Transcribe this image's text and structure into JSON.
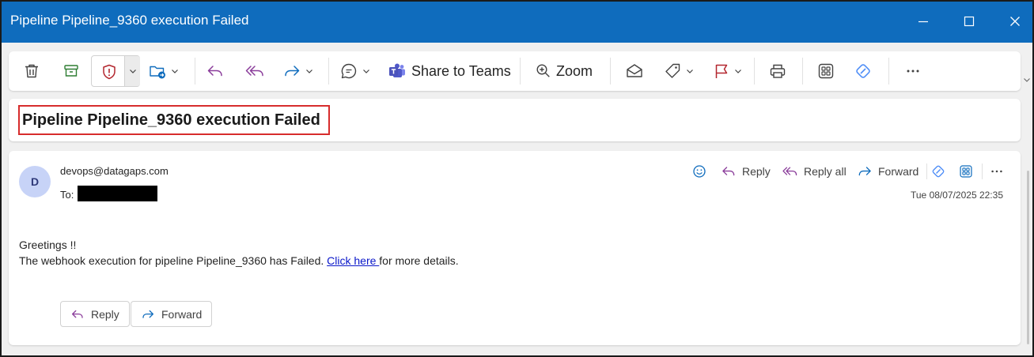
{
  "window": {
    "title": "Pipeline Pipeline_9360 execution Failed"
  },
  "toolbar": {
    "share_label": "Share to Teams",
    "zoom_label": "Zoom"
  },
  "message": {
    "subject": "Pipeline Pipeline_9360 execution Failed",
    "avatar_initial": "D",
    "sender": "devops@datagaps.com",
    "to_label": "To:",
    "date": "Tue 08/07/2025 22:35",
    "actions": {
      "reply": "Reply",
      "reply_all": "Reply all",
      "forward": "Forward"
    },
    "body": {
      "greeting": "Greetings !!",
      "line_prefix": "The webhook execution for pipeline Pipeline_9360 has Failed. ",
      "link_text": "Click here ",
      "line_suffix": "for more details."
    },
    "bottom_buttons": {
      "reply": "Reply",
      "forward": "Forward"
    }
  },
  "colors": {
    "titlebar": "#0f6cbd",
    "highlight_border": "#d72c2c",
    "reply_icon": "#8a3c9a",
    "forward_icon": "#0f6cbd",
    "link": "#0a17c9"
  },
  "icons": {
    "delete": "trash-icon",
    "archive": "archive-icon",
    "report": "shield-icon",
    "move": "folder-move-icon",
    "reply": "reply-arrow-icon",
    "reply_all": "reply-all-icon",
    "forward": "forward-arrow-icon",
    "comment": "chat-bubble-icon",
    "teams": "teams-icon",
    "zoom": "zoom-icon",
    "read": "envelope-open-icon",
    "tag": "tag-icon",
    "flag": "flag-icon",
    "print": "printer-icon",
    "apps": "apps-grid-icon",
    "copilot": "copilot-icon",
    "more": "more-icon",
    "emoji": "smiley-icon"
  }
}
